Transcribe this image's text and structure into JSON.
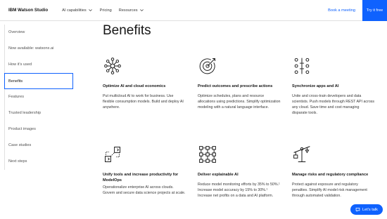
{
  "nav": {
    "brand": "IBM Watson Studio",
    "items": [
      {
        "label": "AI capabilities",
        "dropdown": true
      },
      {
        "label": "Pricing",
        "dropdown": false
      },
      {
        "label": "Resources",
        "dropdown": true
      }
    ],
    "book_meeting": "Book a meeting",
    "try_it": "Try it free"
  },
  "sidebar": {
    "items": [
      {
        "label": "Overview"
      },
      {
        "label": "Now available: watsonx.ai"
      },
      {
        "label": "How it's used"
      },
      {
        "label": "Benefits",
        "active": true
      },
      {
        "label": "Features"
      },
      {
        "label": "Trusted leadership"
      },
      {
        "label": "Product images"
      },
      {
        "label": "Case studies"
      },
      {
        "label": "Next steps"
      }
    ]
  },
  "main": {
    "title": "Benefits",
    "cards": [
      {
        "icon": "network-icon",
        "title": "Optimize AI and cloud economics",
        "body": "Put multicloud AI to work for business. Use flexible consumption models. Build and deploy AI anywhere."
      },
      {
        "icon": "target-icon",
        "title": "Predict outcomes and prescribe actions",
        "body": "Optimize schedules, plans and resource allocations using predictions. Simplify optimization modeling with a natural language interface."
      },
      {
        "icon": "sync-icon",
        "title": "Synchronize apps and AI",
        "body": "Unite and cross-train developers and data scientists. Push models through REST API across any cloud. Save time and cost managing disparate tools."
      },
      {
        "icon": "modelops-icon",
        "title": "Unify tools and increase productivity for ModelOps",
        "body": "Operationalize enterprise AI across clouds. Govern and secure data science projects at scale."
      },
      {
        "icon": "explainable-icon",
        "title": "Deliver explainable AI",
        "body": "Reduce model monitoring efforts by 35% to 50%.¹ Increase model accuracy by 15% to 30%.¹ Increase net profits on a data and AI platform."
      },
      {
        "icon": "scale-icon",
        "title": "Manage risks and regulatory compliance",
        "body": "Protect against exposure and regulatory penalties. Simplify AI model risk management through automated validation."
      }
    ]
  },
  "chat": {
    "label": "Let's talk"
  },
  "colors": {
    "accent": "#0f62fe",
    "text": "#161616",
    "muted": "#525252",
    "border": "#e0e0e0"
  }
}
